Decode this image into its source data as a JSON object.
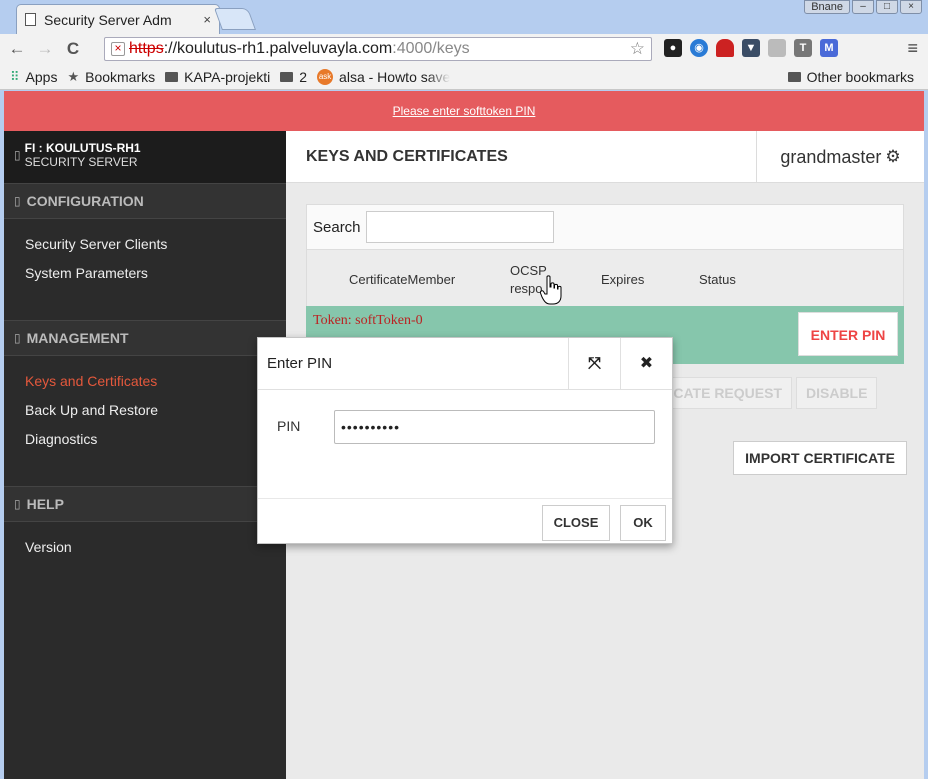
{
  "browser": {
    "tab_title": "Security Server Adm",
    "tab_close": "×",
    "window_user": "Bnane",
    "window_buttons": [
      "–",
      "□",
      "×"
    ],
    "url_scheme": "https",
    "url_host": "://koulutus-rh1.palveluvayla.com",
    "url_path": ":4000/keys",
    "nav_back": "←",
    "nav_forward": "→",
    "nav_reload": "C",
    "star": "☆",
    "menu": "≡",
    "extensions": [
      {
        "name": "keyhole-icon",
        "label": "🔑",
        "color": "#222222"
      },
      {
        "name": "circle-icon",
        "label": "◉",
        "color": "#2a7bd6"
      },
      {
        "name": "sofa-icon",
        "label": "♜",
        "color": "#cc2222"
      },
      {
        "name": "pocket-icon",
        "label": "▼",
        "color": "#3b4d66"
      },
      {
        "name": "ext-gray-icon",
        "label": "▭",
        "color": "#aaaaaa"
      },
      {
        "name": "t-icon",
        "label": "T",
        "color": "#777777"
      },
      {
        "name": "m-icon",
        "label": "M",
        "color": "#4a6ad8"
      }
    ],
    "bookmarks": {
      "apps": "Apps",
      "bookmarks": "Bookmarks",
      "kapa": "KAPA-projekti",
      "two": "2",
      "alsa": "alsa - Howto save",
      "other": "Other bookmarks"
    }
  },
  "alert": {
    "text": "Please enter softtoken PIN"
  },
  "sidebar": {
    "server_id": "FI : KOULUTUS-RH1",
    "server_type": "SECURITY SERVER",
    "sections": {
      "configuration": "CONFIGURATION",
      "management": "MANAGEMENT",
      "help": "HELP"
    },
    "config_items": [
      "Security Server Clients",
      "System Parameters"
    ],
    "management_items": [
      "Keys and Certificates",
      "Back Up and Restore",
      "Diagnostics"
    ],
    "help_items": [
      "Version"
    ]
  },
  "main": {
    "title": "KEYS AND CERTIFICATES",
    "user": "grandmaster",
    "search_label": "Search",
    "columns": {
      "certificate": "Certificate",
      "member": "Member",
      "ocsp_1": "OCSP",
      "ocsp_2": "respo",
      "expires": "Expires",
      "status": "Status"
    },
    "token_label": "Token: softToken-0",
    "enter_pin_button": "ENTER PIN",
    "ghost_buttons": [
      "CATE REQUEST",
      "DISABLE"
    ],
    "import_button": "IMPORT CERTIFICATE"
  },
  "modal": {
    "title": "Enter PIN",
    "pin_label": "PIN",
    "pin_value": "••••••••••",
    "close_button": "CLOSE",
    "ok_button": "OK"
  }
}
